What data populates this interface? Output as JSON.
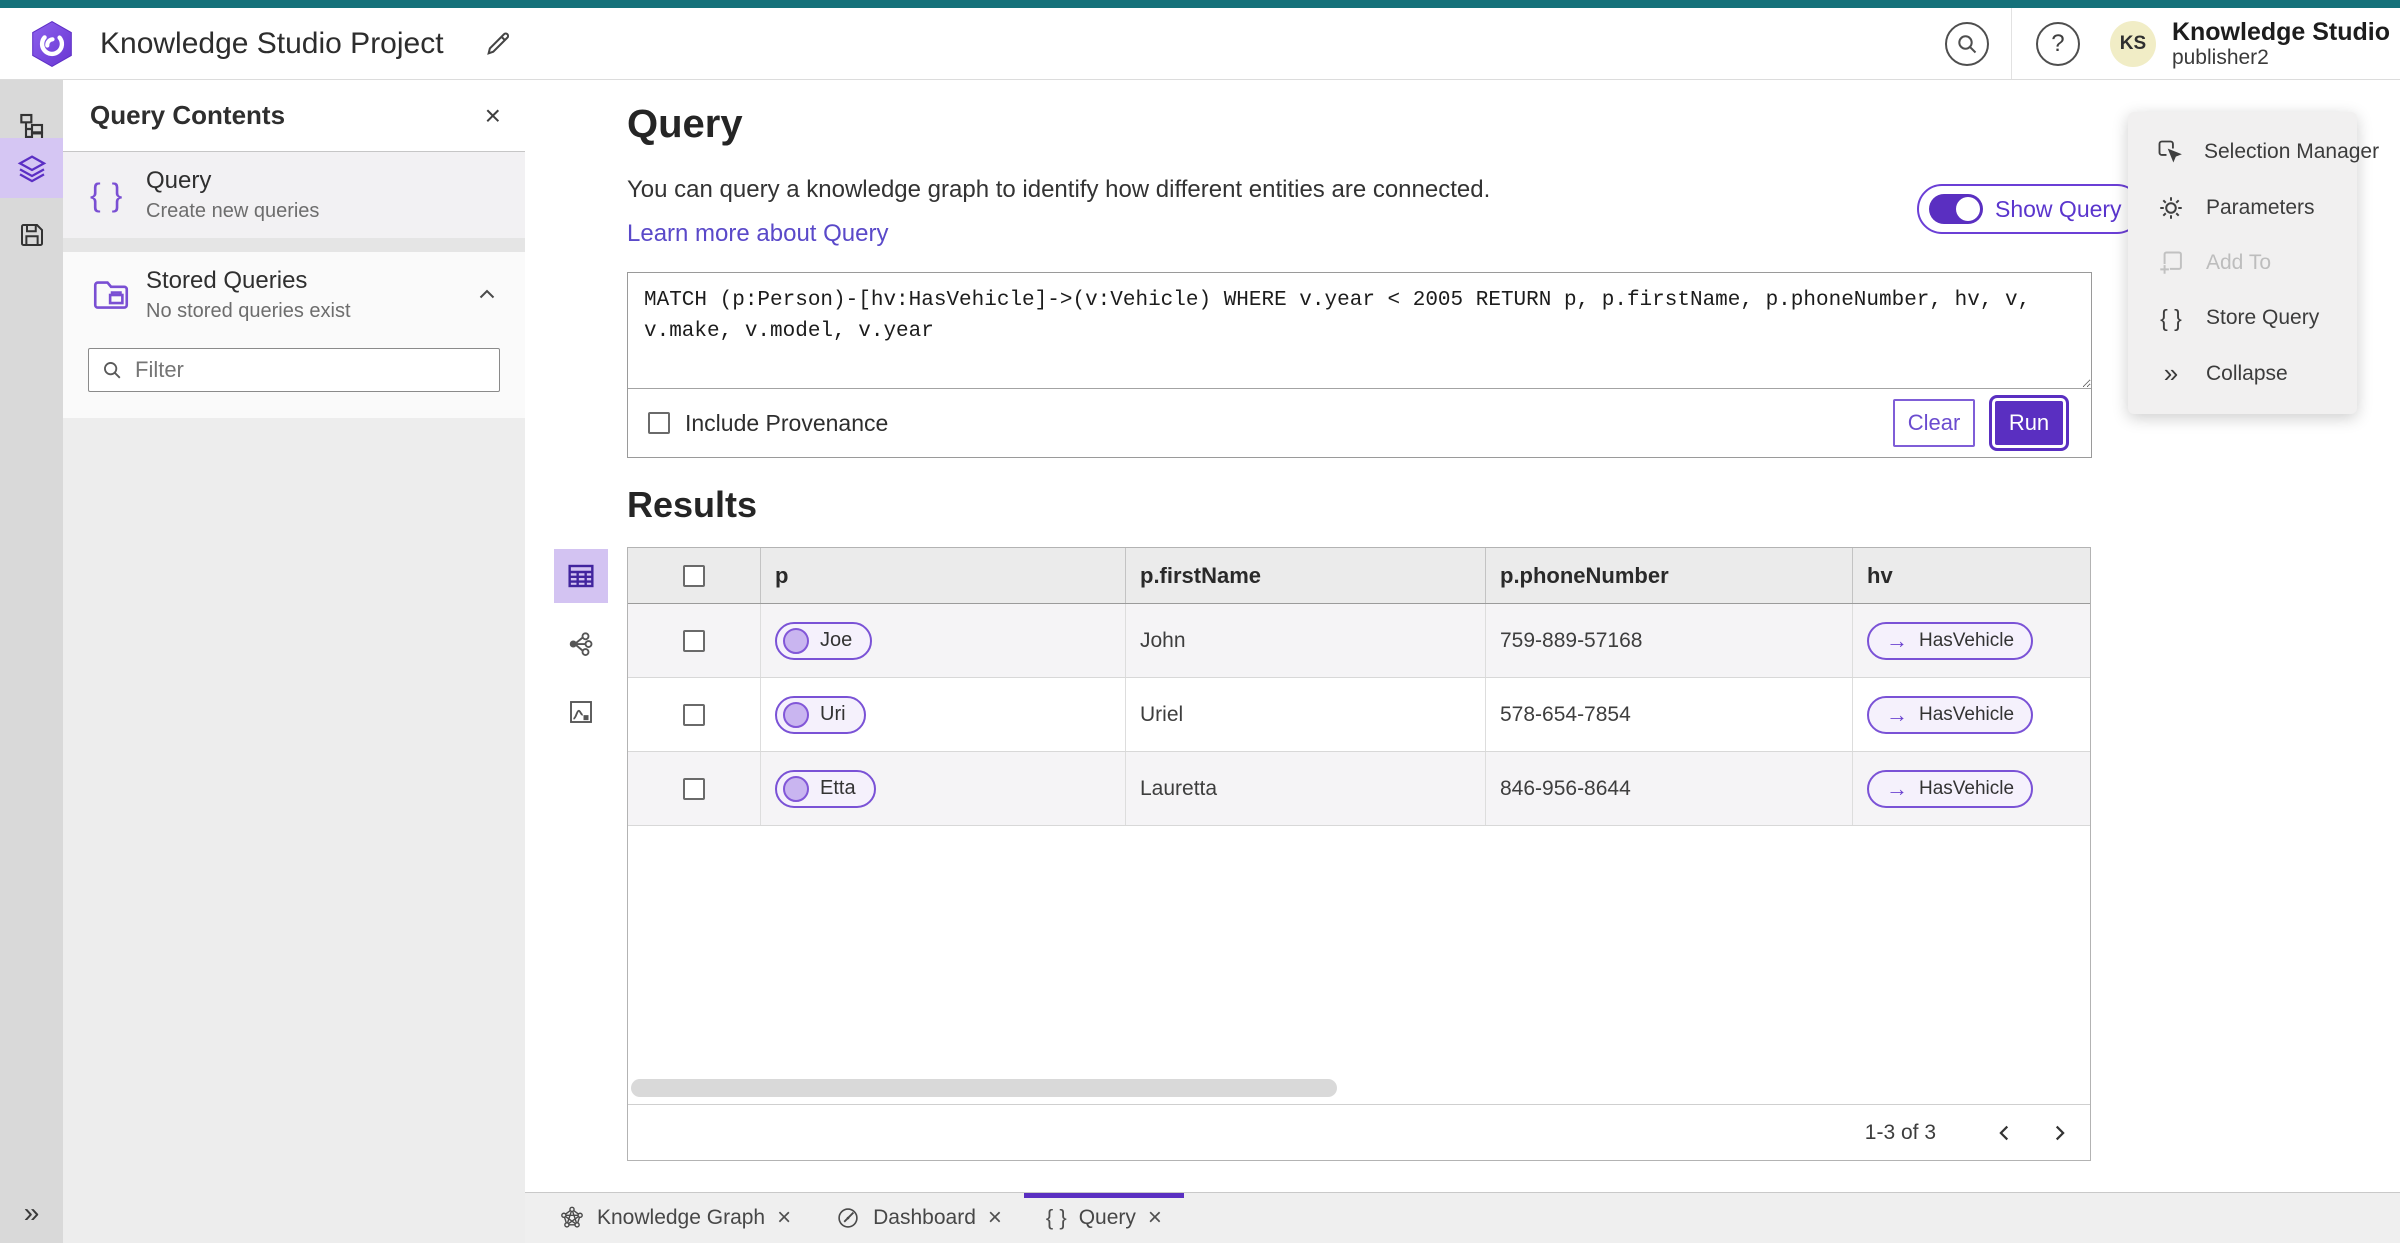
{
  "colors": {
    "accent": "#5a2fc1",
    "accent_light": "#d5c6f3",
    "top_strip": "#15717a",
    "link": "#5a49c9",
    "pill_border": "#7a52d6"
  },
  "header": {
    "project_title": "Knowledge Studio Project",
    "brand_name": "Knowledge Studio",
    "user_name": "publisher2",
    "avatar_initials": "KS",
    "help_glyph": "?"
  },
  "rail": {
    "expand_glyph": "»"
  },
  "contents_panel": {
    "title": "Query Contents",
    "close_glyph": "×",
    "query_item": {
      "icon_glyph": "{ }",
      "label": "Query",
      "sublabel": "Create new queries"
    },
    "stored_item": {
      "label": "Stored Queries",
      "sublabel": "No stored queries exist"
    },
    "filter_placeholder": "Filter"
  },
  "query_section": {
    "heading": "Query",
    "description": "You can query a knowledge graph to identify how different entities are connected.",
    "learn_more_label": "Learn more about Query",
    "show_query_label": "Show Query",
    "query_text": "MATCH (p:Person)-[hv:HasVehicle]->(v:Vehicle) WHERE v.year < 2005 RETURN p, p.firstName, p.phoneNumber, hv, v, v.make, v.model, v.year",
    "include_provenance_label": "Include Provenance",
    "clear_label": "Clear",
    "run_label": "Run"
  },
  "results": {
    "heading": "Results",
    "columns": {
      "p": "p",
      "first_name": "p.firstName",
      "phone": "p.phoneNumber",
      "hv": "hv"
    },
    "arrow_glyph": "→",
    "rows": [
      {
        "p": "Joe",
        "first_name": "John",
        "phone": "759-889-57168",
        "hv": "HasVehicle"
      },
      {
        "p": "Uri",
        "first_name": "Uriel",
        "phone": "578-654-7854",
        "hv": "HasVehicle"
      },
      {
        "p": "Etta",
        "first_name": "Lauretta",
        "phone": "846-956-8644",
        "hv": "HasVehicle"
      }
    ],
    "pagination_label": "1-3 of 3"
  },
  "right_panel": {
    "items": [
      {
        "label": "Selection Manager"
      },
      {
        "label": "Parameters"
      },
      {
        "label": "Add To"
      },
      {
        "label": "Store Query",
        "icon_glyph": "{ }"
      },
      {
        "label": "Collapse",
        "icon_glyph": "»"
      }
    ]
  },
  "tabs": [
    {
      "label": "Knowledge Graph",
      "close_glyph": "×"
    },
    {
      "label": "Dashboard",
      "close_glyph": "×"
    },
    {
      "label": "Query",
      "close_glyph": "×",
      "icon_glyph": "{ }"
    }
  ]
}
